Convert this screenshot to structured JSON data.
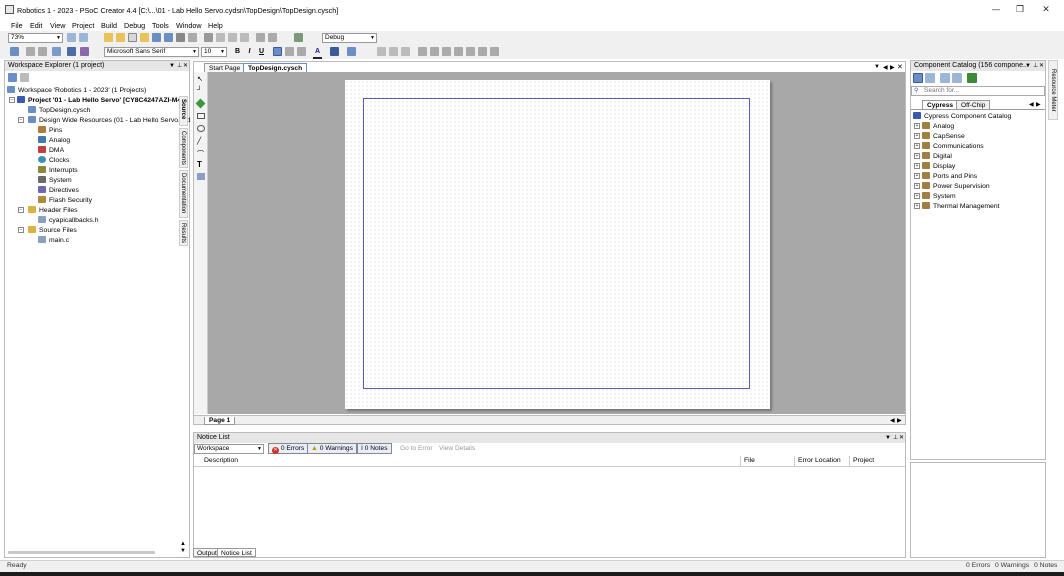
{
  "window": {
    "title": "Robotics 1 - 2023 - PSoC Creator 4.4  [C:\\...\\01 - Lab Hello Servo.cydsn\\TopDesign\\TopDesign.cysch]",
    "controls": [
      "—",
      "❐",
      "✕"
    ]
  },
  "menu": [
    "File",
    "Edit",
    "View",
    "Project",
    "Build",
    "Debug",
    "Tools",
    "Window",
    "Help"
  ],
  "toolbar": {
    "zoom": "73%",
    "config": "Debug",
    "font_name": "Microsoft Sans Serif",
    "font_size": "10",
    "bold": "B",
    "italic": "I",
    "underline": "U",
    "text_color": "A"
  },
  "workspace": {
    "header": "Workspace Explorer (1 project)",
    "workspace_label": "Workspace 'Robotics 1 - 2023' (1 Projects)",
    "project_label": "Project '01 - Lab Hello Servo' [CY8C4247AZI-M4",
    "items": [
      {
        "label": "TopDesign.cysch",
        "indent": 2,
        "color": "#6a8fc8"
      },
      {
        "label": "Design Wide Resources (01 - Lab Hello Servo.cyd",
        "indent": 2,
        "color": "#6a8fc8"
      },
      {
        "label": "Pins",
        "indent": 3,
        "color": "#b07a3c"
      },
      {
        "label": "Analog",
        "indent": 3,
        "color": "#3c7ab0"
      },
      {
        "label": "DMA",
        "indent": 3,
        "color": "#c04040"
      },
      {
        "label": "Clocks",
        "indent": 3,
        "color": "#3c8fb0"
      },
      {
        "label": "Interrupts",
        "indent": 3,
        "color": "#8a8a3c"
      },
      {
        "label": "System",
        "indent": 3,
        "color": "#6a6a6a"
      },
      {
        "label": "Directives",
        "indent": 3,
        "color": "#6a6ab0"
      },
      {
        "label": "Flash Security",
        "indent": 3,
        "color": "#b08a3c"
      },
      {
        "label": "Header Files",
        "indent": 2,
        "color": "#e0b040"
      },
      {
        "label": "cyapicallbacks.h",
        "indent": 3,
        "color": "#8aa0c0"
      },
      {
        "label": "Source Files",
        "indent": 2,
        "color": "#e0b040"
      },
      {
        "label": "main.c",
        "indent": 3,
        "color": "#8aa0c0"
      }
    ],
    "side_tabs": [
      "Source",
      "Components",
      "Documentation",
      "Results"
    ]
  },
  "editor": {
    "tabs": [
      "Start Page",
      "TopDesign.cysch"
    ],
    "active_tab": "TopDesign.cysch",
    "page_tab": "Page 1"
  },
  "notice": {
    "header": "Notice List",
    "scope": "Workspace",
    "errors": "0 Errors",
    "warnings": "0 Warnings",
    "notes": "0 Notes",
    "go_to_error": "Go to Error",
    "view_details": "View Details",
    "columns": [
      "Description",
      "File",
      "Error Location",
      "Project"
    ],
    "bottom_tabs": [
      "Output",
      "Notice List"
    ]
  },
  "catalog": {
    "header": "Component Catalog (156 compone...",
    "search_placeholder": "Search for...",
    "tabs": [
      "Cypress",
      "Off-Chip"
    ],
    "root": "Cypress Component Catalog",
    "items": [
      "Analog",
      "CapSense",
      "Communications",
      "Digital",
      "Display",
      "Ports and Pins",
      "Power Supervision",
      "System",
      "Thermal Management"
    ],
    "vertical_tab": "Resource Meter"
  },
  "status": {
    "left": "Ready",
    "errors": "0 Errors",
    "warnings": "0 Warnings",
    "notes": "0 Notes"
  }
}
